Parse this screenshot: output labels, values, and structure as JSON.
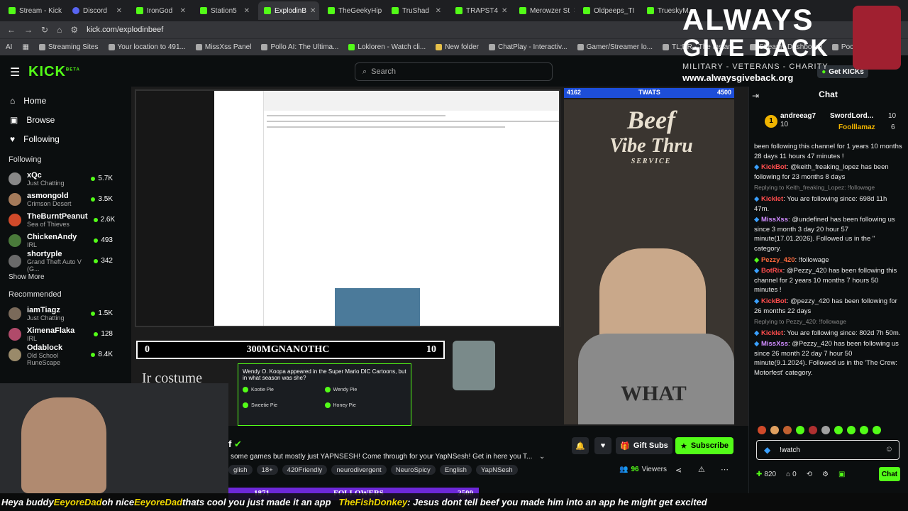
{
  "browser": {
    "tabs": [
      "Stream - Kick",
      "Discord",
      "IronGod",
      "Station5",
      "ExplodinB",
      "TheGeekyHip",
      "TruShad",
      "TRAPST4",
      "Merowzer St",
      "Oldpeeps_TI",
      "TrueskyM..."
    ],
    "url": "kick.com/explodinbeef",
    "bookmarks": [
      "Streaming Sites",
      "Your location to 491...",
      "MissXss Panel",
      "Pollo AI: The Ultima...",
      "Lokloren - Watch cli...",
      "New folder",
      "ChatPlay - Interactiv...",
      "Gamer/Streamer lo...",
      "TL;DR - The Instant...",
      "Streamy Dashboard",
      "Pocketment Panel"
    ]
  },
  "kick": {
    "logo": "KICK",
    "beta": "BETA",
    "search_placeholder": "Search",
    "get_kicks": "Get KICKs"
  },
  "sidebar": {
    "nav": [
      {
        "label": "Home",
        "icon": "home-icon"
      },
      {
        "label": "Browse",
        "icon": "browse-icon"
      },
      {
        "label": "Following",
        "icon": "heart-icon"
      }
    ],
    "following_title": "Following",
    "following": [
      {
        "name": "xQc",
        "category": "Just Chatting",
        "viewers": "5.7K"
      },
      {
        "name": "asmongold",
        "category": "Crimson Desert",
        "viewers": "3.5K"
      },
      {
        "name": "TheBurntPeanut",
        "category": "Sea of Thieves",
        "viewers": "2.6K"
      },
      {
        "name": "ChickenAndy",
        "category": "IRL",
        "viewers": "493"
      },
      {
        "name": "shortyple",
        "category": "Grand Theft Auto V (G...",
        "viewers": "342"
      }
    ],
    "show_more": "Show More",
    "recommended_title": "Recommended",
    "recommended": [
      {
        "name": "iamTiagz",
        "category": "Just Chatting",
        "viewers": "1.5K"
      },
      {
        "name": "XimenaFlaka",
        "category": "IRL",
        "viewers": "128"
      },
      {
        "name": "Odablock",
        "category": "Old School RuneScape",
        "viewers": "8.4K"
      }
    ]
  },
  "stream": {
    "top_bar_left": "4162",
    "top_bar_mid": "TWATS",
    "top_bar_right": "4500",
    "beef_logo_line1": "Beef",
    "beef_logo_line2": "Vibe Thru",
    "beef_logo_line3": "SERVICE",
    "quiz_left": "0",
    "quiz_name": "300MGNANOTHC",
    "quiz_right": "10",
    "quiz_question": "Wendy O. Koopa appeared in the Super Mario DIC Cartoons, but in what season was she?",
    "quiz_options": [
      "Kootie Pie",
      "Wendy Pie",
      "Sweetie Pie",
      "Honey Pie"
    ],
    "costume_text": "Ir costume",
    "shirt_text": "WHAT"
  },
  "info": {
    "title": "some games but mostly just YAPNSESH! Come through for your YapNSesh! Get in here you T...",
    "tags": [
      "glish",
      "18+",
      "420Friendly",
      "neurodivergent",
      "NeuroSpicy",
      "English",
      "YapNSesh"
    ],
    "gift_subs": "Gift Subs",
    "subscribe": "Subscribe",
    "viewers_count": "96",
    "viewers_label": "Viewers"
  },
  "followers_bar": {
    "left": "1871",
    "label": "FOLLOWERS",
    "right": "2500"
  },
  "ticker": {
    "name1": "EeyoreDad",
    "text1": "Heya buddy ",
    "text2": " oh nice ",
    "text3": " thats cool you just made it an app",
    "name2": "TheFishDonkey",
    "text4": ": Jesus dont tell beef you made him into an app he might get excited"
  },
  "chat": {
    "title": "Chat",
    "pins": [
      {
        "name": "andreeag7",
        "count": "10"
      },
      {
        "name": "SwordLord...",
        "count": "10"
      },
      {
        "name": "Foolllamaz",
        "count": "6"
      }
    ],
    "messages": [
      {
        "user": "",
        "text": "been following this channel for 1 years 10 months 28 days 11 hours 47 minutes !",
        "color": "#eaeaea"
      },
      {
        "user": "KickBot",
        "text": ": @keith_freaking_lopez has been following for 23 months 8 days",
        "color": "#ff4d4d"
      },
      {
        "user": "",
        "reply": "Replying to Keith_freaking_Lopez: !followage"
      },
      {
        "user": "Kicklet",
        "text": ": You are following since: 698d 11h 47m.",
        "color": "#ff4d4d"
      },
      {
        "user": "MissXss",
        "text": ": @undefined has been following us since 3 month 3 day 20 hour 57 minute(17.01.2026). Followed us in the '' category.",
        "color": "#d08cff"
      },
      {
        "user": "Pezzy_420",
        "text": ": !followage",
        "color": "#ff6a3d"
      },
      {
        "user": "BotRix",
        "text": ": @Pezzy_420 has been following this channel for 2 years 10 months 7 hours 50 minutes !",
        "color": "#ff4d4d"
      },
      {
        "user": "KickBot",
        "text": ": @pezzy_420 has been following for 26 months 22 days",
        "color": "#ff4d4d"
      },
      {
        "user": "",
        "reply": "Replying to Pezzy_420: !followage"
      },
      {
        "user": "Kicklet",
        "text": ": You are following since: 802d 7h 50m.",
        "color": "#ff4d4d"
      },
      {
        "user": "MissXss",
        "text": ": @Pezzy_420 has been following us since 26 month 22 day 7 hour 50 minute(9.1.2024). Followed us in the 'The Crew: Motorfest' category.",
        "color": "#d08cff"
      }
    ],
    "input_value": "!watch",
    "points": "820",
    "zero": "0",
    "send": "Chat"
  },
  "overlay": {
    "line1": "ALWAYS",
    "line2": "GIVE BACK",
    "sub": "MILITARY - VETERANS - CHARITY",
    "web": "www.alwaysgiveback.org"
  }
}
